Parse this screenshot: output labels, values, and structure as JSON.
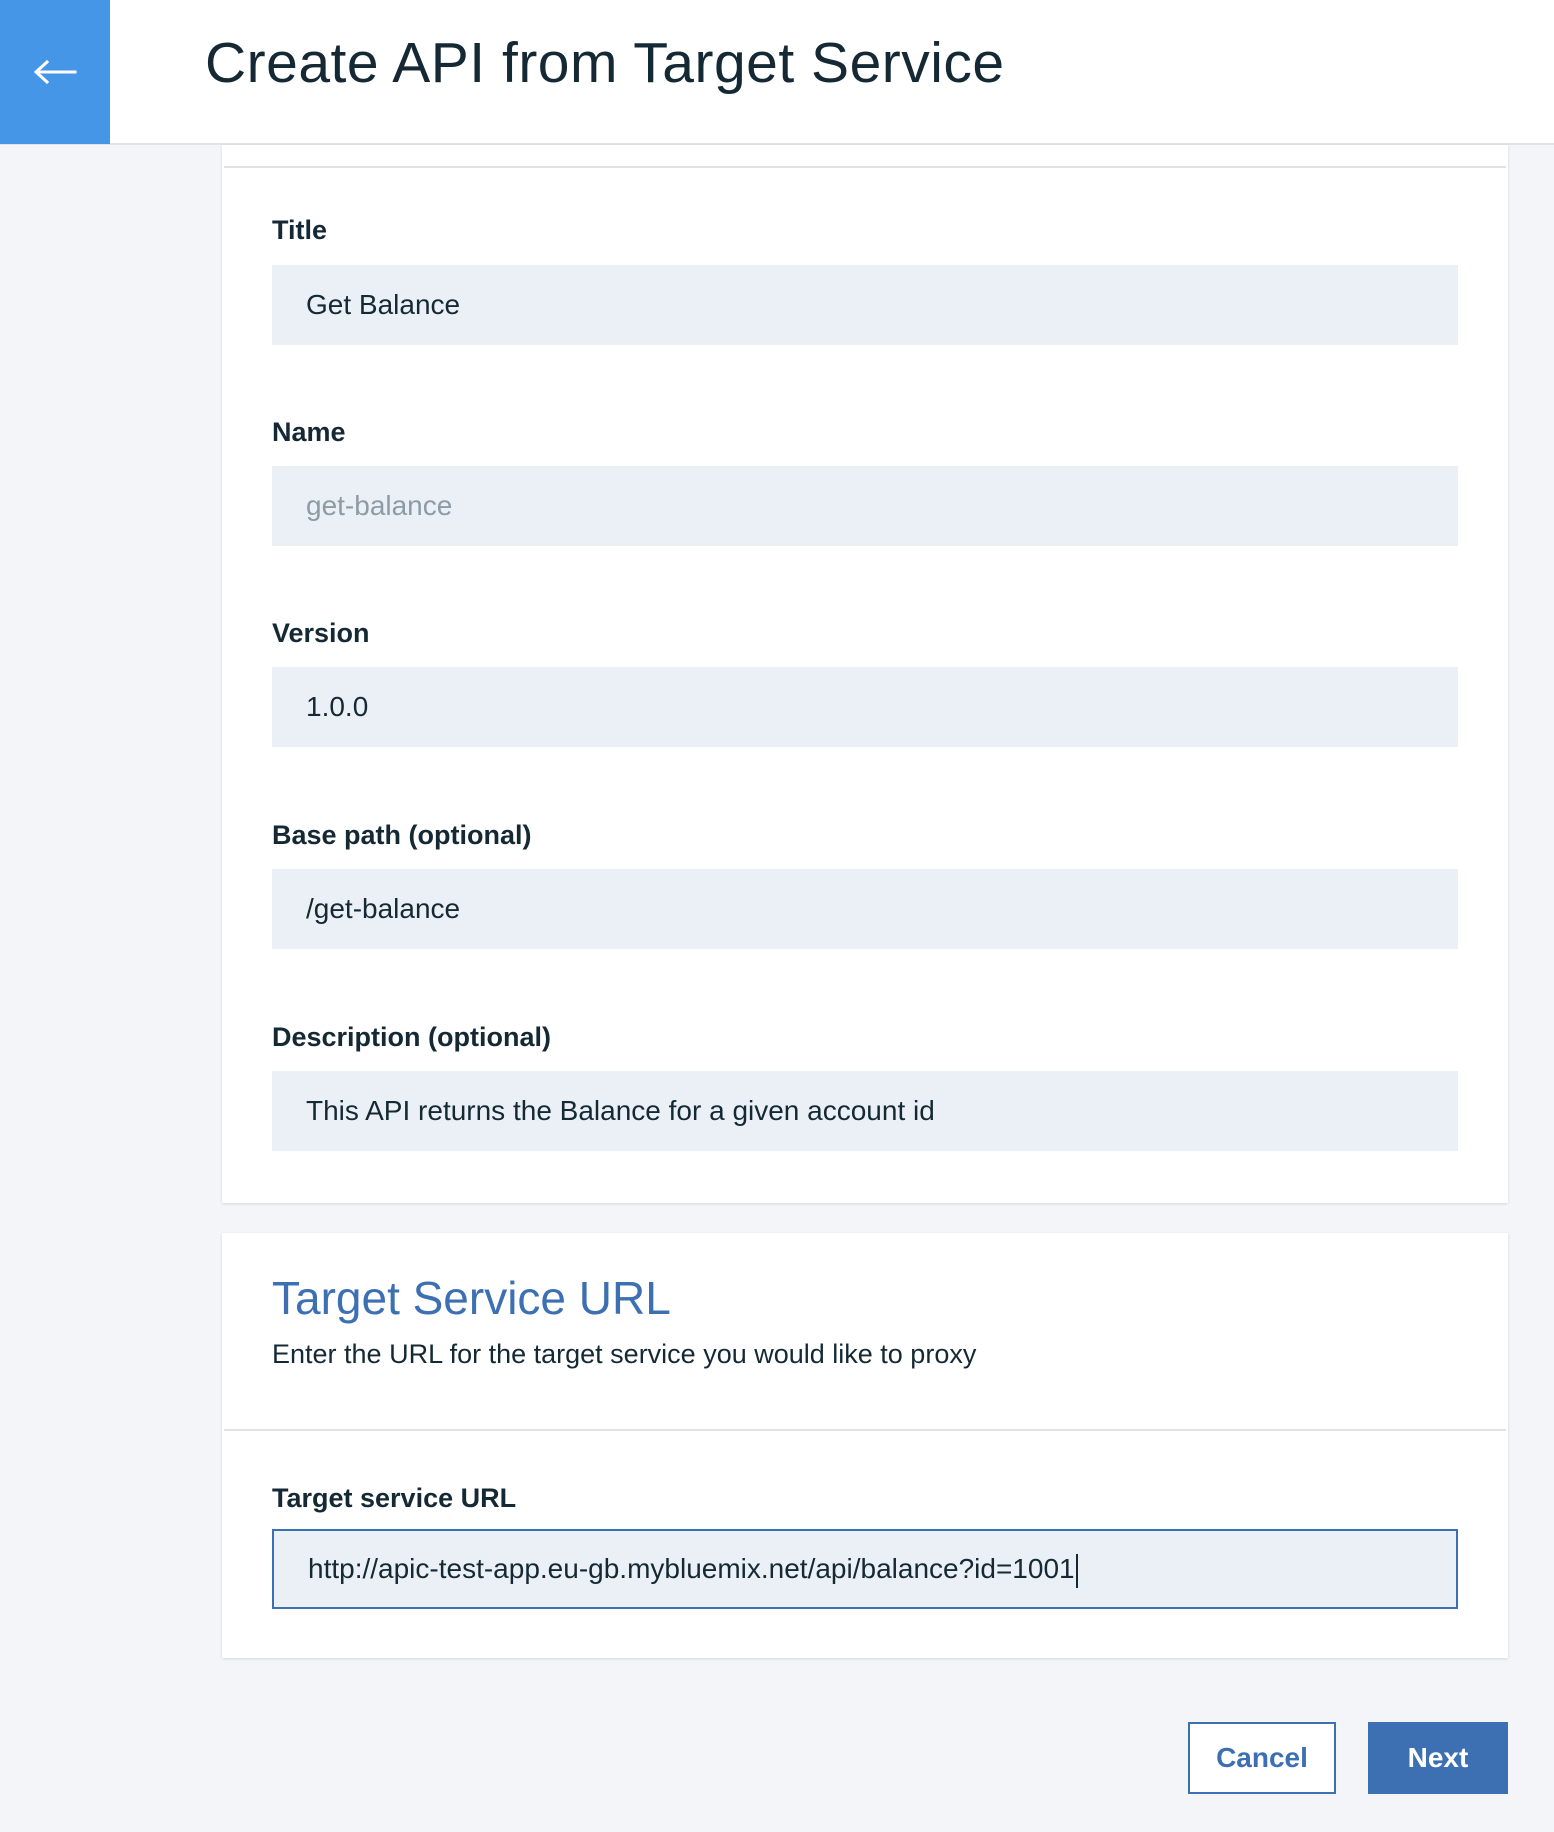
{
  "header": {
    "title": "Create API from Target Service",
    "back_icon": "arrow-left-icon",
    "accent_color": "#4596e6"
  },
  "info_form": {
    "fields": [
      {
        "label": "Title",
        "value": "Get Balance"
      },
      {
        "label": "Name",
        "value": "get-balance"
      },
      {
        "label": "Version",
        "value": "1.0.0"
      },
      {
        "label": "Base path (optional)",
        "value": "/get-balance"
      },
      {
        "label": "Description (optional)",
        "value": "This API returns the Balance for a given account id"
      }
    ]
  },
  "target_section": {
    "title": "Target Service URL",
    "subtitle": "Enter the URL for the target service you would like to proxy",
    "field_label": "Target service URL",
    "field_value": "http://apic-test-app.eu-gb.mybluemix.net/api/balance?id=1001"
  },
  "actions": {
    "cancel_label": "Cancel",
    "next_label": "Next",
    "primary_color": "#3d70b2"
  }
}
